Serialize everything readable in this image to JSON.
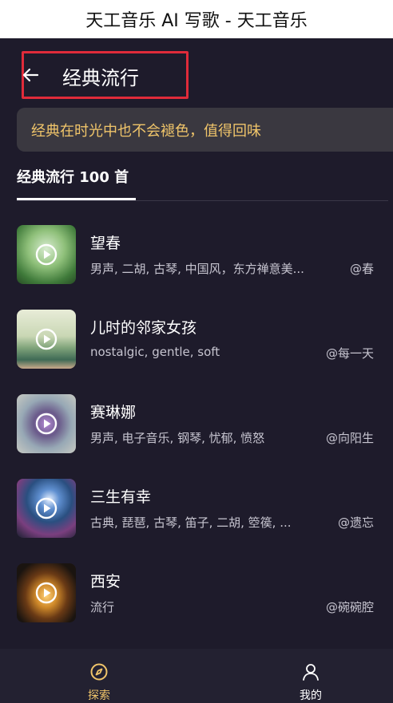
{
  "window": {
    "title": "天工音乐 AI 写歌 - 天工音乐"
  },
  "header": {
    "title": "经典流行",
    "back_icon": "arrow-left-icon"
  },
  "banner": {
    "text": "经典在时光中也不会褪色，值得回味"
  },
  "tabs": [
    {
      "label": "经典流行 100 首",
      "active": true
    }
  ],
  "songs": [
    {
      "title": "望春",
      "tags": "男声, 二胡, 古琴, 中国风，东方禅意美...",
      "author": "@春"
    },
    {
      "title": "儿时的邻家女孩",
      "tags": "nostalgic, gentle, soft",
      "author": "@每一天"
    },
    {
      "title": "赛琳娜",
      "tags": "男声, 电子音乐, 钢琴, 忧郁, 愤怒",
      "author": "@向阳生"
    },
    {
      "title": "三生有幸",
      "tags": "古典, 琵琶, 古琴, 笛子, 二胡, 箜篌, ...",
      "author": "@遗忘"
    },
    {
      "title": "西安",
      "tags": "流行",
      "author": "@碗碗腔"
    }
  ],
  "bottom_nav": [
    {
      "label": "探索",
      "icon": "compass-icon",
      "active": true
    },
    {
      "label": "我的",
      "icon": "user-icon",
      "active": false
    }
  ],
  "colors": {
    "accent": "#f0c56a",
    "background": "#1e1b2b",
    "highlight": "#e02b3a"
  }
}
